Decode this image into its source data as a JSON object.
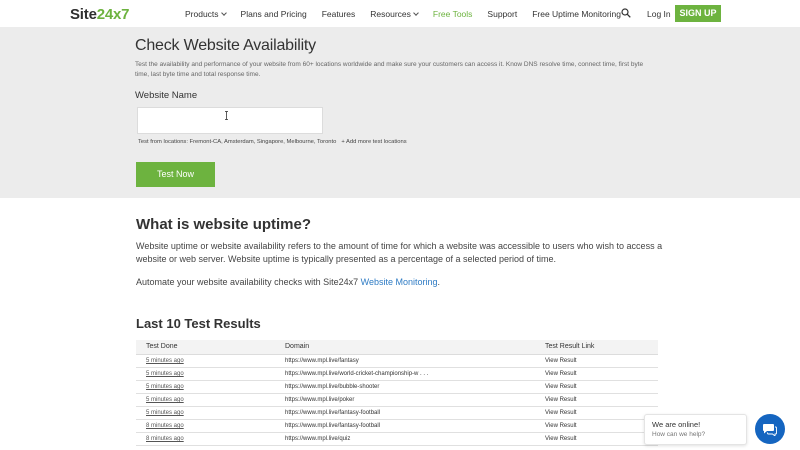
{
  "header": {
    "logo": {
      "text_main": "Site",
      "text_accent": "24x7"
    },
    "nav": [
      {
        "label": "Products",
        "dropdown": true,
        "active": false
      },
      {
        "label": "Plans and Pricing",
        "dropdown": false,
        "active": false
      },
      {
        "label": "Features",
        "dropdown": false,
        "active": false
      },
      {
        "label": "Resources",
        "dropdown": true,
        "active": false
      },
      {
        "label": "Free Tools",
        "dropdown": false,
        "active": true
      },
      {
        "label": "Support",
        "dropdown": false,
        "active": false
      },
      {
        "label": "Free Uptime Monitoring",
        "dropdown": false,
        "active": false
      }
    ],
    "search_icon": "search-icon",
    "login_label": "Log In",
    "signup_label": "SIGN UP"
  },
  "hero": {
    "title": "Check Website Availability",
    "description": "Test the availability and performance of your website from 60+ locations worldwide and make sure your customers can access it. Know DNS resolve time, connect time, first byte time, last byte time and total response time.",
    "input_label": "Website Name",
    "input_value": "",
    "locations_text": "Test from locations: Fremont-CA, Amsterdam, Singapore, Melbourne, Toronto",
    "add_locations_label": "+ Add more test locations",
    "test_button_label": "Test Now"
  },
  "uptime": {
    "title": "What is website uptime?",
    "paragraph1": "Website uptime or website availability refers to the amount of time for which a website was accessible to users who wish to access a website or web server. Website uptime is typically presented as a percentage of a selected period of time.",
    "paragraph2_prefix": "Automate your website availability checks with Site24x7 ",
    "paragraph2_link": "Website Monitoring",
    "paragraph2_suffix": "."
  },
  "results": {
    "title": "Last 10 Test Results",
    "columns": [
      "Test Done",
      "Domain",
      "Test Result Link"
    ],
    "rows": [
      {
        "time": "5 minutes ago",
        "domain": "https://www.mpl.live/fantasy",
        "link": "View Result"
      },
      {
        "time": "5 minutes ago",
        "domain": "https://www.mpl.live/world-cricket-championship-w . . .",
        "link": "View Result"
      },
      {
        "time": "5 minutes ago",
        "domain": "https://www.mpl.live/bubble-shooter",
        "link": "View Result"
      },
      {
        "time": "5 minutes ago",
        "domain": "https://www.mpl.live/poker",
        "link": "View Result"
      },
      {
        "time": "5 minutes ago",
        "domain": "https://www.mpl.live/fantasy-football",
        "link": "View Result"
      },
      {
        "time": "8 minutes ago",
        "domain": "https://www.mpl.live/fantasy-football",
        "link": "View Result"
      },
      {
        "time": "8 minutes ago",
        "domain": "https://www.mpl.live/quiz",
        "link": "View Result"
      }
    ]
  },
  "chat": {
    "online_text": "We are online!",
    "help_text": "How can we help?",
    "icon": "chat-icon"
  },
  "colors": {
    "accent_green": "#6db33f",
    "link_blue": "#2e7bc4",
    "chat_blue": "#1565c0"
  }
}
